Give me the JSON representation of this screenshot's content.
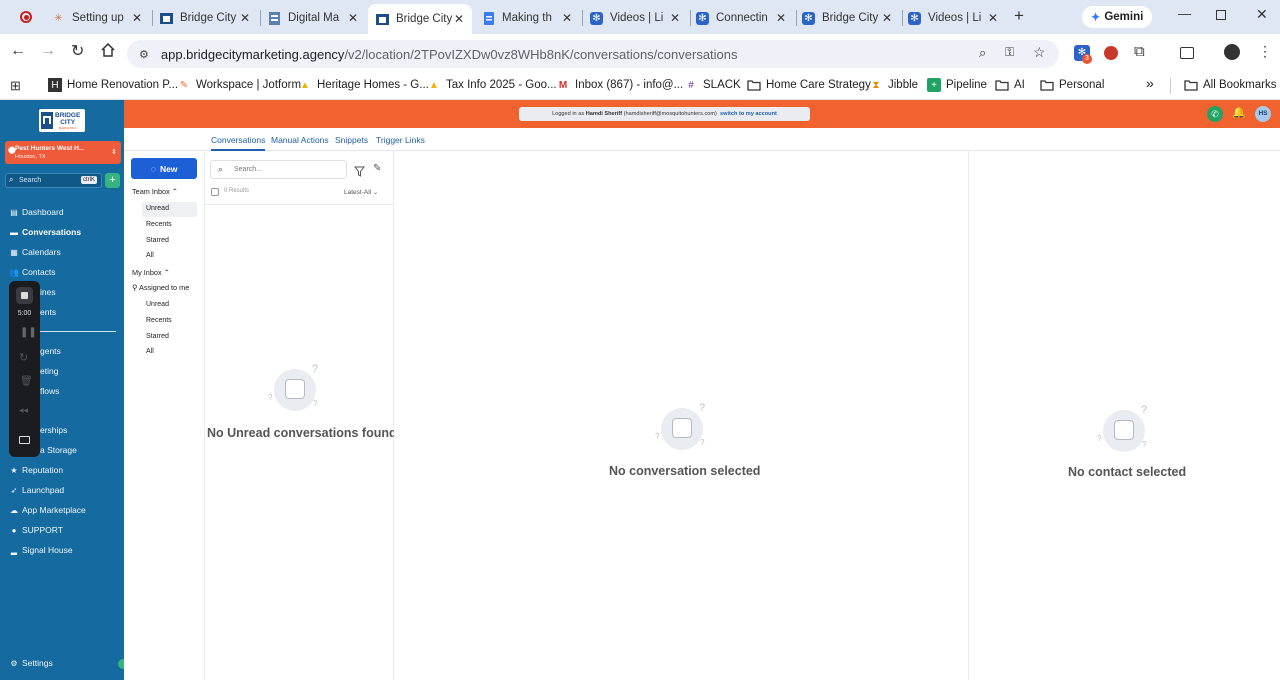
{
  "browser": {
    "tabs": [
      {
        "label": "Setting up",
        "icon": "claude-icon"
      },
      {
        "label": "Bridge City",
        "icon": "bcm-icon"
      },
      {
        "label": "Digital Ma",
        "icon": "doc-icon"
      },
      {
        "label": "Bridge City",
        "icon": "bcm-icon",
        "active": true
      },
      {
        "label": "Making th",
        "icon": "gdocs-icon"
      },
      {
        "label": "Videos | Li",
        "icon": "gear-icon"
      },
      {
        "label": "Connectin",
        "icon": "gear-icon"
      },
      {
        "label": "Bridge City",
        "icon": "gear-icon"
      },
      {
        "label": "Videos | Li",
        "icon": "gear-icon"
      }
    ],
    "gemini_label": "Gemini",
    "url_host": "app.bridgecitymarketing.agency",
    "url_path": "/v2/location/2TPovIZXDw0vz8WHb8nK/conversations/conversations",
    "extension_badge": "3",
    "bookmarks": [
      "Home Renovation P...",
      "Workspace | Jotform",
      "Heritage Homes - G...",
      "Tax Info 2025 - Goo...",
      "Inbox (867) - info@...",
      "SLACK",
      "Home Care Strategy",
      "Jibble",
      "Pipeline",
      "AI",
      "Personal"
    ],
    "more_bookmarks": "»",
    "all_bookmarks": "All Bookmarks"
  },
  "sidebar": {
    "logo_line1": "BRIDGE",
    "logo_line2": "CITY",
    "logo_line3": "MARKETING",
    "location_name": "Pest Hunters West H...",
    "location_sub": "Houston, TX",
    "search_placeholder": "Search",
    "search_shortcut": "ctrlK",
    "nav": [
      "Dashboard",
      "Conversations",
      "Calendars",
      "Contacts",
      "ines",
      "ents",
      "gents",
      "eting",
      "flows",
      "erships",
      "a Storage",
      "Reputation",
      "Launchpad",
      "App Marketplace",
      "SUPPORT",
      "Signal House"
    ],
    "settings": "Settings"
  },
  "recorder": {
    "time": "5:00"
  },
  "banner": {
    "prefix": "Logged in as",
    "user": "Hamdi Sheriff",
    "email": "(hamdisheriff@mosquitohunters.com)",
    "switch_link": "switch to my account",
    "avatar_initials": "HS"
  },
  "section_tabs": [
    "Conversations",
    "Manual Actions",
    "Snippets",
    "Trigger Links"
  ],
  "inbox": {
    "new_button": "New",
    "team_inbox": "Team Inbox",
    "team_items": [
      "Unread",
      "Recents",
      "Starred",
      "All"
    ],
    "my_inbox": "My Inbox",
    "assigned": "Assigned to me",
    "my_items": [
      "Unread",
      "Recents",
      "Starred",
      "All"
    ]
  },
  "list": {
    "search_placeholder": "Search...",
    "results": "0 Results",
    "sort": "Latest-All",
    "empty": "No Unread conversations found"
  },
  "conversation_panel": {
    "empty": "No conversation selected"
  },
  "contact_panel": {
    "empty": "No contact selected"
  },
  "colors": {
    "sidebar": "#156aa0",
    "header_strip": "#f0622e",
    "new_button": "#1d5fd6",
    "location_chip": "#ee5a3a"
  }
}
